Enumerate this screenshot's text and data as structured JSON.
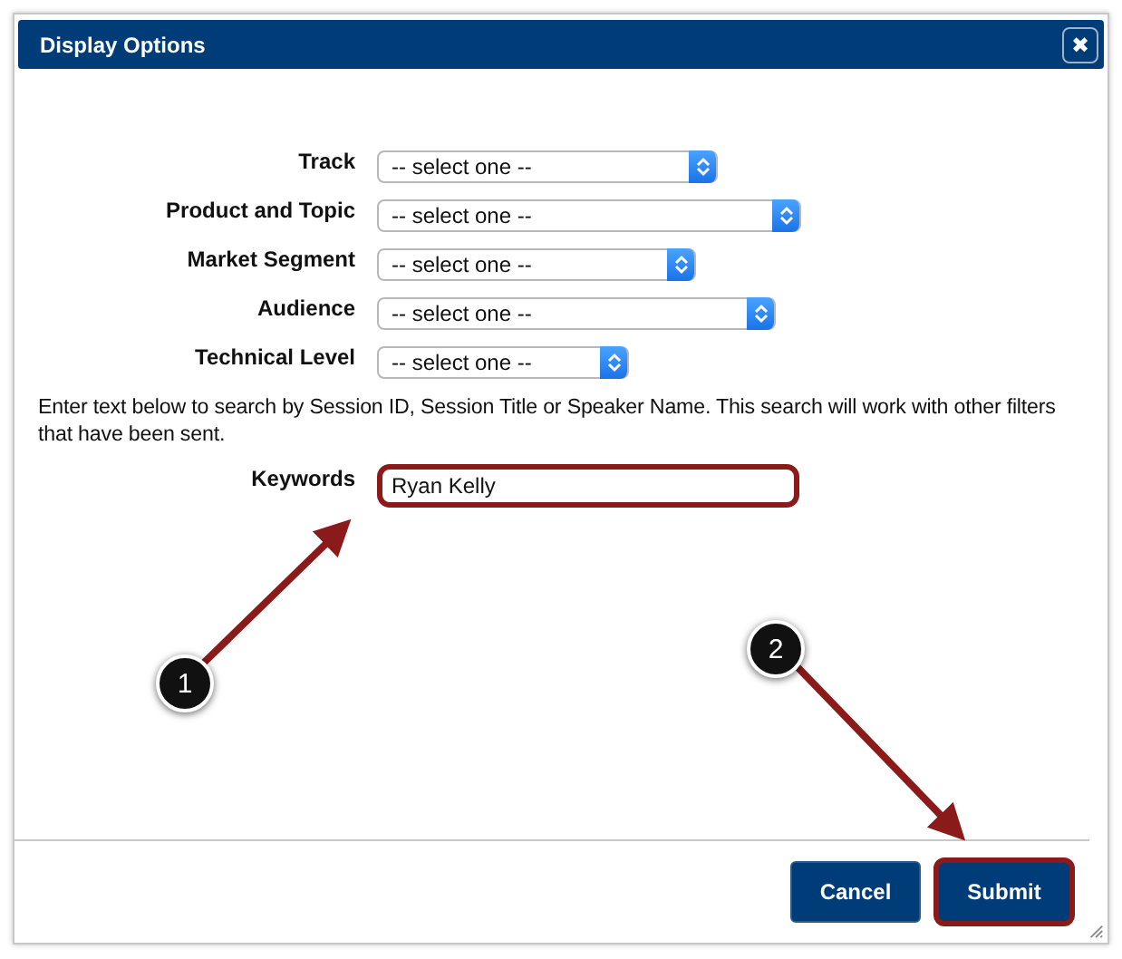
{
  "dialog": {
    "title": "Display Options",
    "close": "✖"
  },
  "filters": [
    {
      "label": "Track",
      "value": "-- select one --"
    },
    {
      "label": "Product and Topic",
      "value": "-- select one --"
    },
    {
      "label": "Market Segment",
      "value": "-- select one --"
    },
    {
      "label": "Audience",
      "value": "-- select one --"
    },
    {
      "label": "Technical Level",
      "value": "-- select one --"
    }
  ],
  "help_text": "Enter text below to search by Session ID, Session Title or Speaker Name. This search will work with other filters that have been sent.",
  "keywords": {
    "label": "Keywords",
    "value": "Ryan Kelly",
    "highlighted": true
  },
  "buttons": [
    {
      "label": "Cancel",
      "highlighted": false
    },
    {
      "label": "Submit",
      "highlighted": true
    }
  ],
  "callouts": [
    {
      "number": "1"
    },
    {
      "number": "2"
    }
  ]
}
